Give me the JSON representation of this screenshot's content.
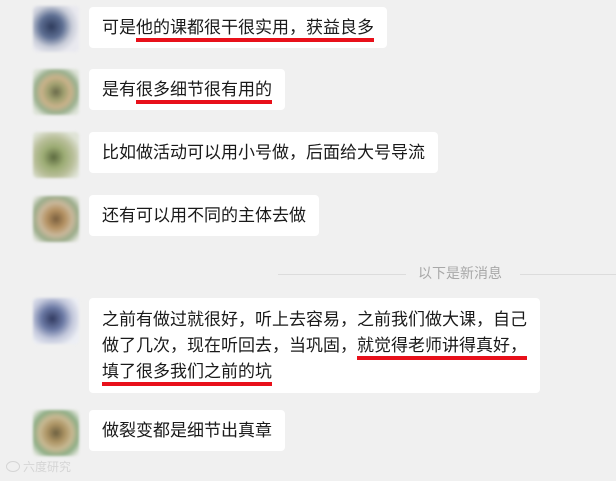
{
  "messages": [
    {
      "avatar": "avatar-1",
      "parts": [
        {
          "text": "可是",
          "underline": false
        },
        {
          "text": "他的课都很干很实用，获益良多",
          "underline": true
        }
      ]
    },
    {
      "avatar": "avatar-2",
      "parts": [
        {
          "text": "是有",
          "underline": false
        },
        {
          "text": "很多细节很有用的",
          "underline": true
        }
      ]
    },
    {
      "avatar": "avatar-3",
      "parts": [
        {
          "text": "比如做活动可以用小号做，后面给大号导流",
          "underline": false
        }
      ]
    },
    {
      "avatar": "avatar-4",
      "parts": [
        {
          "text": "还有可以用不同的主体去做",
          "underline": false
        }
      ]
    },
    {
      "avatar": "avatar-5",
      "lines": [
        [
          {
            "text": "之前有做过就很好，听上去容易，之前我们做大课，自己",
            "underline": false
          }
        ],
        [
          {
            "text": "做了几次，现在听回去，当巩固，",
            "underline": false
          },
          {
            "text": "就觉得老师讲得真好，",
            "underline": true
          }
        ],
        [
          {
            "text": "填了很多我们之前的坑",
            "underline": true
          }
        ]
      ]
    },
    {
      "avatar": "avatar-6",
      "parts": [
        {
          "text": "做裂变都是细节出真章",
          "underline": false
        }
      ]
    }
  ],
  "divider": {
    "text": "以下是新消息"
  },
  "watermark": {
    "text": "六度研究",
    "icon": "weibo-logo-icon"
  },
  "colors": {
    "background": "#f0f0f0",
    "bubble": "#ffffff",
    "highlight_underline": "#e8101a",
    "divider_text": "#a8a8a8"
  }
}
